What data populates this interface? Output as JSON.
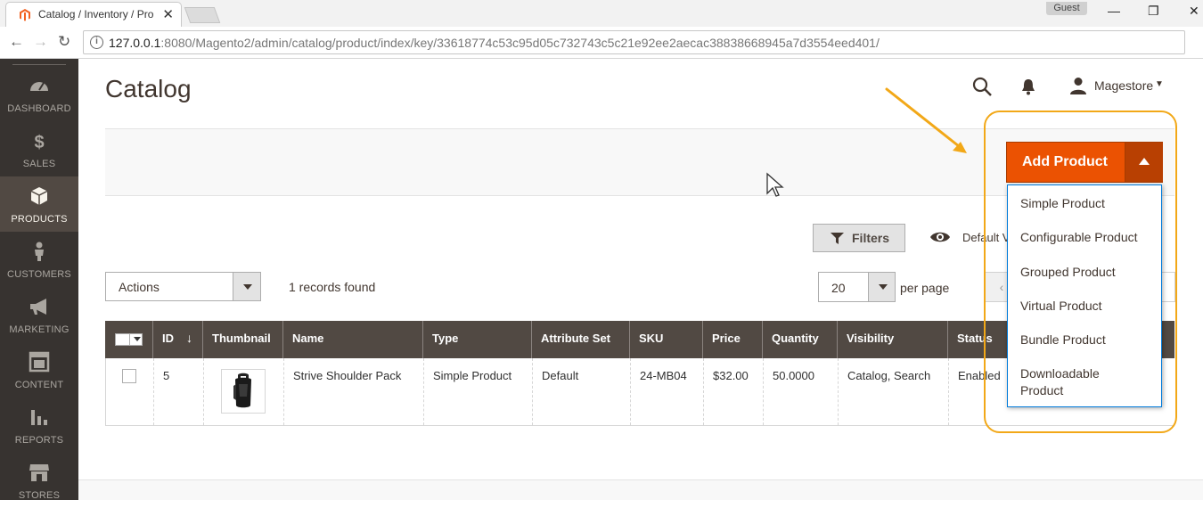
{
  "browser": {
    "tab_title": "Catalog / Inventory / Pro",
    "tab_close": "✕",
    "profile": "Guest",
    "win_minimize": "—",
    "win_maximize": "❐",
    "win_close": "✕",
    "url_host": "127.0.0.1",
    "url_rest": ":8080/Magento2/admin/catalog/product/index/key/33618774c53c95d05c732743c5c21e92ee2aecac38838668945a7d3554eed401/",
    "back": "←",
    "forward": "→",
    "reload": "↻"
  },
  "sidebar": {
    "items": [
      {
        "label": "DASHBOARD",
        "icon": "dashboard-icon"
      },
      {
        "label": "SALES",
        "icon": "dollar-icon"
      },
      {
        "label": "PRODUCTS",
        "icon": "cube-icon"
      },
      {
        "label": "CUSTOMERS",
        "icon": "person-icon"
      },
      {
        "label": "MARKETING",
        "icon": "megaphone-icon"
      },
      {
        "label": "CONTENT",
        "icon": "layout-icon"
      },
      {
        "label": "REPORTS",
        "icon": "bar-chart-icon"
      },
      {
        "label": "STORES",
        "icon": "store-icon"
      }
    ],
    "active": "PRODUCTS"
  },
  "header": {
    "title": "Catalog",
    "username": "Magestore",
    "user_caret": "▼"
  },
  "add_product": {
    "label": "Add Product",
    "menu": [
      "Simple Product",
      "Configurable Product",
      "Grouped Product",
      "Virtual Product",
      "Bundle Product",
      "Downloadable Product"
    ]
  },
  "toolbar": {
    "filters": "Filters",
    "view": "Default View",
    "actions": "Actions",
    "records": "1 records found",
    "per_page_value": "20",
    "per_page_label": "per page",
    "prev": "‹"
  },
  "grid": {
    "columns": [
      "ID",
      "Thumbnail",
      "Name",
      "Type",
      "Attribute Set",
      "SKU",
      "Price",
      "Quantity",
      "Visibility",
      "Status"
    ],
    "sort_indicator": "↓",
    "rows": [
      {
        "id": "5",
        "name": "Strive Shoulder Pack",
        "type": "Simple Product",
        "attribute_set": "Default",
        "sku": "24-MB04",
        "price": "$32.00",
        "quantity": "50.0000",
        "visibility": "Catalog, Search",
        "status": "Enabled"
      }
    ]
  },
  "colors": {
    "accent": "#eb5202",
    "sidebar": "#373330",
    "table_header": "#514943",
    "highlight": "#f2a818"
  }
}
